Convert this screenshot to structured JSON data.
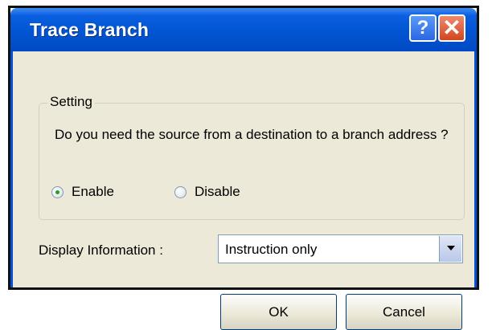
{
  "window": {
    "title": "Trace Branch",
    "help_glyph": "?",
    "close_glyph": "✕",
    "icons": [
      "help-icon",
      "close-icon",
      "chevron-down-icon"
    ]
  },
  "setting": {
    "legend": "Setting",
    "question": "Do you need the source from a destination to a branch address ?",
    "options": [
      {
        "label": "Enable",
        "checked": true
      },
      {
        "label": "Disable",
        "checked": false
      }
    ]
  },
  "display": {
    "label": "Display Information :",
    "selected": "Instruction only"
  },
  "buttons": {
    "ok": "OK",
    "cancel": "Cancel"
  }
}
